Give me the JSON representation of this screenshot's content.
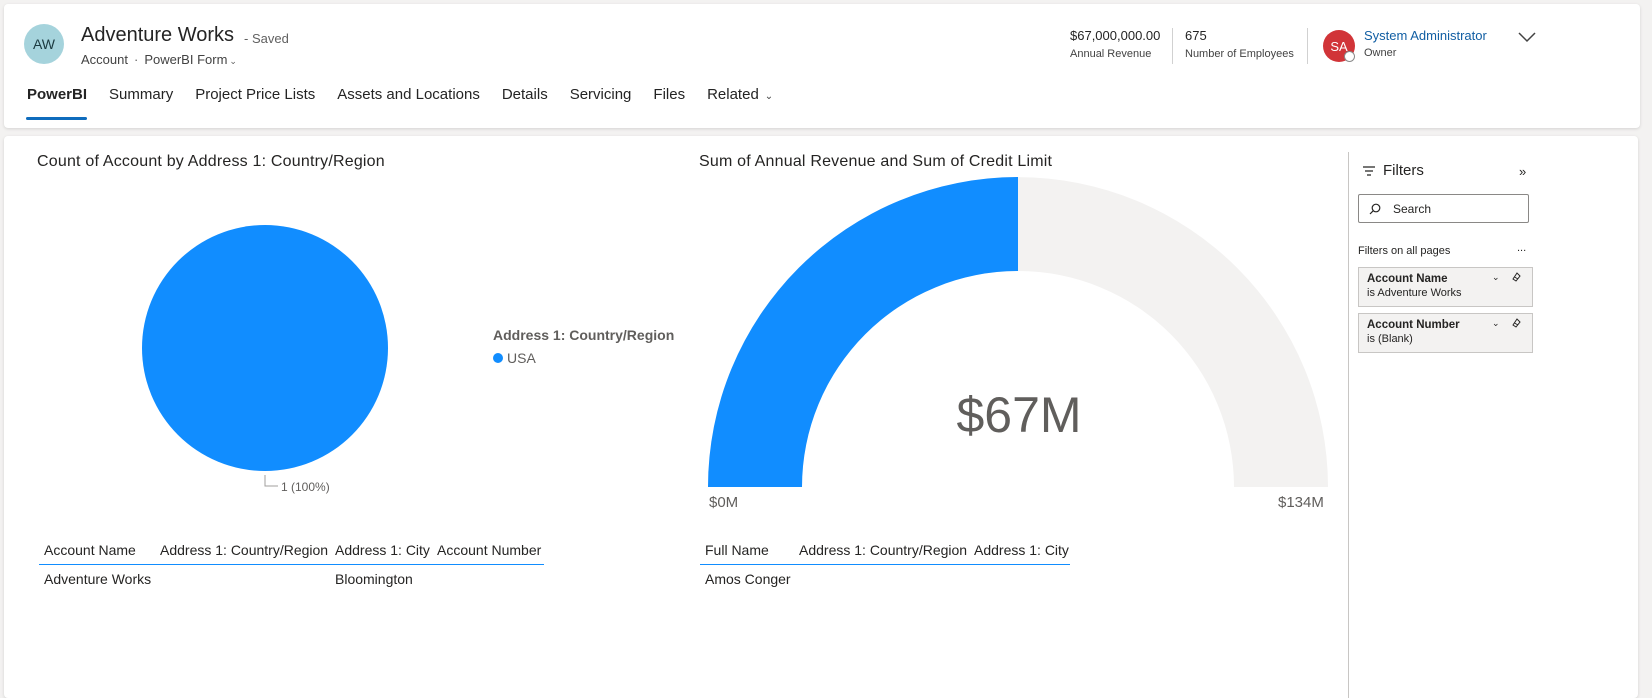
{
  "header": {
    "avatar_initials": "AW",
    "title": "Adventure Works",
    "saved_status": "- Saved",
    "entity": "Account",
    "separator": "·",
    "form": "PowerBI Form",
    "kpis": [
      {
        "value": "$67,000,000.00",
        "label": "Annual Revenue"
      },
      {
        "value": "675",
        "label": "Number of Employees"
      }
    ],
    "owner": {
      "initials": "SA",
      "name": "System Administrator",
      "role": "Owner"
    },
    "tabs": [
      {
        "label": "PowerBI",
        "active": true
      },
      {
        "label": "Summary"
      },
      {
        "label": "Project Price Lists"
      },
      {
        "label": "Assets and Locations"
      },
      {
        "label": "Details"
      },
      {
        "label": "Servicing"
      },
      {
        "label": "Files"
      },
      {
        "label": "Related"
      }
    ]
  },
  "report": {
    "pie_title": "Count of Account by Address 1: Country/Region",
    "pie_legend_title": "Address 1: Country/Region",
    "pie_legend_item": "USA",
    "pie_data_label": "1 (100%)",
    "gauge_title": "Sum of Annual Revenue and Sum of Credit Limit",
    "gauge_value_label": "$67M",
    "gauge_min_label": "$0M",
    "gauge_max_label": "$134M",
    "table1": {
      "headers": [
        "Account Name",
        "Address 1: Country/Region",
        "Address 1: City",
        "Account Number"
      ],
      "rows": [
        [
          "Adventure Works",
          "",
          "Bloomington",
          ""
        ]
      ]
    },
    "table2": {
      "headers": [
        "Full Name",
        "Address 1: Country/Region",
        "Address 1: City"
      ],
      "rows": [
        [
          "Amos Conger",
          "",
          ""
        ]
      ]
    }
  },
  "filters": {
    "title": "Filters",
    "search_placeholder": "Search",
    "section": "Filters on all pages",
    "more": "...",
    "cards": [
      {
        "name": "Account Name",
        "value": "is Adventure Works"
      },
      {
        "name": "Account Number",
        "value": "is (Blank)"
      }
    ]
  },
  "chart_data": [
    {
      "type": "pie",
      "title": "Count of Account by Address 1: Country/Region",
      "legend_title": "Address 1: Country/Region",
      "categories": [
        "USA"
      ],
      "values": [
        1
      ],
      "data_labels": [
        "1 (100%)"
      ],
      "color": "#118dff"
    },
    {
      "type": "gauge",
      "title": "Sum of Annual Revenue and Sum of Credit Limit",
      "value": 67,
      "min": 0,
      "max": 134,
      "unit": "$M",
      "fill_color": "#118dff",
      "track_color": "#f3f2f1"
    }
  ]
}
